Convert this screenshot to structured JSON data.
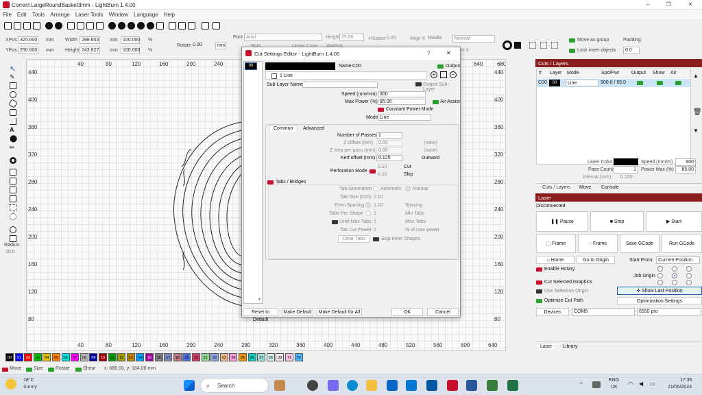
{
  "window": {
    "title": "Correct LargeRoundBasket3mm - LightBurn 1.4.00",
    "min": "–",
    "max": "❐",
    "close": "✕"
  },
  "menu": [
    "File",
    "Edit",
    "Tools",
    "Arrange",
    "Laser Tools",
    "Window",
    "Language",
    "Help"
  ],
  "position": {
    "xpos_label": "XPos",
    "xpos": "325.000",
    "ypos_label": "YPos",
    "ypos": "250.000",
    "mm1": "mm",
    "mm2": "mm",
    "width_label": "Width",
    "width": "298.603",
    "height_label": "Height",
    "height": "243.827",
    "mm3": "mm",
    "mm4": "mm",
    "wpct": "100.000",
    "hpct": "100.000",
    "pct1": "%",
    "pct2": "%",
    "rotate_label": "Rotate",
    "rotate": "0.00",
    "unit": "mm"
  },
  "textbar": {
    "font_label": "Font",
    "font": "Arial",
    "height_label": "Height",
    "height": "25.00",
    "hspace_label": "HSpace",
    "hspace": "0.00",
    "align_label": "Align X",
    "align": "Middle",
    "style": "Normal",
    "bold": "Bold",
    "upper": "Upper Case",
    "welded": "Welded",
    "offset": "et 0"
  },
  "rightbar": {
    "move_group": "Move as group",
    "lock_inner": "Lock inner objects",
    "padding_label": "Padding:",
    "padding": "0.0"
  },
  "left_tools": {
    "radius_label": "Radius:",
    "radius": "10.0"
  },
  "ruler_top": [
    "40",
    "80",
    "120",
    "160",
    "200",
    "240",
    "640",
    "680"
  ],
  "ruler_bottom": [
    "40",
    "80",
    "120",
    "160",
    "200",
    "240",
    "280",
    "320",
    "360",
    "400",
    "440",
    "480",
    "520",
    "560",
    "600",
    "640"
  ],
  "ruler_left": [
    "440",
    "400",
    "360",
    "320",
    "280",
    "240",
    "200",
    "160",
    "120",
    "80",
    "40"
  ],
  "ruler_right": [
    "440",
    "400",
    "360",
    "320",
    "280",
    "240",
    "200",
    "160",
    "120",
    "80",
    "40"
  ],
  "palette": [
    {
      "label": "00",
      "color": "#000000",
      "text": "#ffffff"
    },
    {
      "label": "01",
      "color": "#0000ff",
      "text": "#ffffff"
    },
    {
      "label": "02",
      "color": "#ff0000",
      "text": "#ffffff"
    },
    {
      "label": "03",
      "color": "#00c000",
      "text": "#000000"
    },
    {
      "label": "04",
      "color": "#e0c000",
      "text": "#000000"
    },
    {
      "label": "05",
      "color": "#ff8000",
      "text": "#000000"
    },
    {
      "label": "06",
      "color": "#00e0e0",
      "text": "#000000"
    },
    {
      "label": "07",
      "color": "#ff00ff",
      "text": "#000000"
    },
    {
      "label": "08",
      "color": "#b4b4b4",
      "text": "#000000"
    },
    {
      "label": "09",
      "color": "#0000a0",
      "text": "#ffffff"
    },
    {
      "label": "10",
      "color": "#a00000",
      "text": "#ffffff"
    },
    {
      "label": "11",
      "color": "#00a000",
      "text": "#000000"
    },
    {
      "label": "12",
      "color": "#a0a000",
      "text": "#000000"
    },
    {
      "label": "13",
      "color": "#c08000",
      "text": "#000000"
    },
    {
      "label": "14",
      "color": "#00a0ff",
      "text": "#000000"
    },
    {
      "label": "15",
      "color": "#a000a0",
      "text": "#ffffff"
    },
    {
      "label": "16",
      "color": "#808080",
      "text": "#000000"
    },
    {
      "label": "17",
      "color": "#7d87b9",
      "text": "#000000"
    },
    {
      "label": "18",
      "color": "#bb7784",
      "text": "#000000"
    },
    {
      "label": "19",
      "color": "#4a6fe3",
      "text": "#000000"
    },
    {
      "label": "20",
      "color": "#d33f6a",
      "text": "#000000"
    },
    {
      "label": "21",
      "color": "#8cd78f",
      "text": "#000000"
    },
    {
      "label": "22",
      "color": "#8e9fdd",
      "text": "#000000"
    },
    {
      "label": "23",
      "color": "#f0b98d",
      "text": "#000000"
    },
    {
      "label": "24",
      "color": "#f79cd4",
      "text": "#000000"
    },
    {
      "label": "25",
      "color": "#ef9708",
      "text": "#000000"
    },
    {
      "label": "26",
      "color": "#0fcfc0",
      "text": "#000000"
    },
    {
      "label": "27",
      "color": "#9cded6",
      "text": "#000000"
    },
    {
      "label": "28",
      "color": "#d5eae7",
      "text": "#000000"
    },
    {
      "label": "29",
      "color": "#f3e1eb",
      "text": "#000000"
    },
    {
      "label": "T1",
      "color": "#f6c4e1",
      "text": "#000000"
    },
    {
      "label": "T2",
      "color": "#4ab4ff",
      "text": "#000000"
    }
  ],
  "statusbar": {
    "move": "Move",
    "size": "Size",
    "rotate": "Rotate",
    "shear": "Shear",
    "coords": "x: 686.00, y: 184.00 mm"
  },
  "cuts": {
    "title": "Cuts / Layers",
    "headers": [
      "#",
      "Layer",
      "Mode",
      "Spd/Pwr",
      "Output",
      "Show",
      "Air"
    ],
    "row": {
      "id": "C00",
      "layer": "00",
      "mode": "Line",
      "spdpwr": "900.0 / 85.0"
    },
    "layer_color_label": "Layer Color",
    "speed_label": "Speed (mm/m)",
    "speed": "900",
    "pass_label": "Pass Count",
    "pass": "1",
    "power_label": "Power Max (%)",
    "power": "85.00",
    "interval_label": "Interval (mm)",
    "interval": "0.100",
    "tabs": [
      "Cuts / Layers",
      "Move",
      "Console"
    ]
  },
  "laser": {
    "title": "Laser",
    "status": "Disconnected",
    "pause": "Pause",
    "stop": "Stop",
    "start": "Start",
    "frame1": "Frame",
    "frame2": "Frame",
    "save_gcode": "Save GCode",
    "run_gcode": "Run GCode",
    "home": "Home",
    "goto_origin": "Go to Origin",
    "start_from_label": "Start From:",
    "start_from": "Current Position",
    "enable_rotary": "Enable Rotary",
    "job_origin": "Job Origin",
    "cut_selected": "Cut Selected Graphics",
    "use_selection": "Use Selection Origin",
    "show_last": "Show Last Position",
    "optimize_cut": "Optimize Cut Path",
    "opt_settings": "Optimization Settings",
    "devices": "Devices",
    "port": "COM5",
    "device": "6550 pro",
    "tabs": [
      "Laser",
      "Library"
    ]
  },
  "dialog": {
    "title": "Cut Settings Editor - LightBurn 1.4.00",
    "help": "?",
    "close": "✕",
    "layer_chip": "00",
    "name_label": "Name",
    "name": "C00",
    "output": "Output",
    "sublayer_count": "1 Line",
    "sublayer_name_label": "Sub-Layer Name",
    "output_sublayer": "Output Sub-Layer",
    "speed_label": "Speed (mm/min)",
    "speed": "300",
    "power_label": "Max Power (%)",
    "power": "85.00",
    "air_assist": "Air Assist",
    "const_power": "Constant Power Mode",
    "mode_label": "Mode",
    "mode": "Line",
    "tabs": [
      "Common",
      "Advanced"
    ],
    "passes_label": "Number of Passes",
    "passes": "1",
    "zoffset_label": "Z Offset (mm)",
    "zoffset": "0.00",
    "zoffset_note": "(none)",
    "zstep_label": "Z step per pass (mm)",
    "zstep": "0.00",
    "zstep_note": "(none)",
    "kerf_label": "Kerf offset (mm)",
    "kerf": "0.125",
    "kerf_note": "Outward",
    "perf_label": "Perforation Mode",
    "perf_cut": "0.10",
    "perf_cut_label": "Cut",
    "perf_skip": "0.10",
    "perf_skip_label": "Skip",
    "tabs_bridges": "Tabs / Bridges",
    "tabgen_label": "Tab Generation",
    "tabgen_auto": "Automatic",
    "tabgen_manual": "Manual",
    "tabsize_label": "Tab Size (mm)",
    "tabsize": "0.10",
    "even_label": "Even Spacing",
    "even": "1.10",
    "even_unit": "Spacing",
    "pershape_label": "Tabs Per Shape",
    "pershape": "1",
    "pershape_unit": "Min Tabs",
    "limit_label": "Limit Max Tabs",
    "limit": "1",
    "limit_unit": "Max Tabs",
    "tabcut_label": "Tab Cut Power",
    "tabcut": "0",
    "tabcut_unit": "% of max power",
    "clear_tabs": "Clear Tabs",
    "skip_inner": "Skip Inner Shapes",
    "reset_default": "Reset to Default",
    "make_default": "Make Default",
    "make_default_all": "Make Default for All",
    "ok": "OK",
    "cancel": "Cancel"
  },
  "taskbar": {
    "temp": "18°C",
    "weather": "Sunny",
    "search": "Search",
    "lang1": "ENG",
    "lang2": "UK",
    "time": "17:35",
    "date": "21/05/2023"
  },
  "colors": {
    "accent": "#8b1d1d",
    "toggle_on": "#2ca02c",
    "selection": "#cce4f7"
  }
}
